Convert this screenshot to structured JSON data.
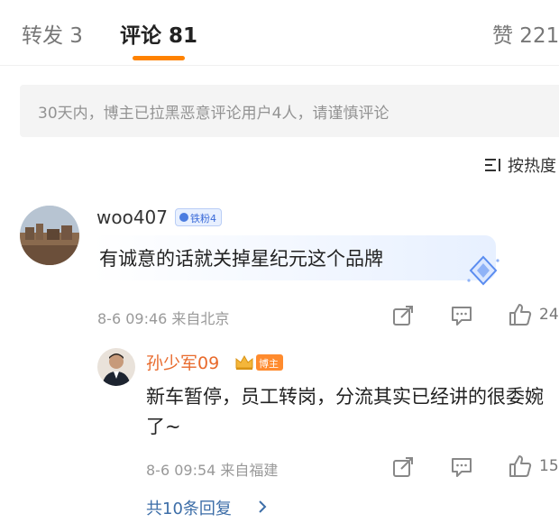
{
  "tabs": {
    "repost": "转发 3",
    "comments": "评论 81",
    "likes": "赞 221"
  },
  "notice": "30天内，博主已拉黑恶意评论用户4人，请谨慎评论",
  "sort": {
    "label": "按热度",
    "icon": "sort-lines-icon"
  },
  "comment": {
    "username": "woo407",
    "fan_badge": "铁粉4",
    "text": "有诚意的话就关掉星纪元这个品牌",
    "meta": "8-6 09:46  来自北京",
    "likes": "24"
  },
  "reply": {
    "username": "孙少军09",
    "op_badge": "博主",
    "text": "新车暂停，员工转岗，分流其实已经讲的很委婉了~",
    "meta": "8-6 09:54  来自福建",
    "likes": "15"
  },
  "more_replies": "共10条回复",
  "colors": {
    "accent": "#ff8200",
    "op_name": "#e86a2c",
    "link": "#3d6ea8"
  }
}
